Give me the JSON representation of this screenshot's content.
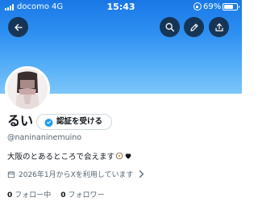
{
  "status_bar": {
    "carrier": "docomo",
    "network": "4G",
    "time": "15:43",
    "battery_percent": "69%",
    "battery_level": 0.69,
    "rotation_lock_icon": "rotation-lock-icon"
  },
  "header": {
    "back_icon": "arrow-left-icon",
    "search_icon": "search-icon",
    "edit_icon": "pencil-icon",
    "share_icon": "share-icon"
  },
  "profile": {
    "display_name": "るい",
    "verify_button_label": "認証を受ける",
    "handle": "@naninaninemuino",
    "bio": "大阪のとあるところで会えます",
    "bio_emojis": [
      "sparkle-emoji",
      "heart-emoji"
    ],
    "joined": "2026年1月からXを利用しています",
    "following_count": "0",
    "following_label": "フォロー中",
    "followers_count": "0",
    "followers_label": "フォロワー"
  },
  "colors": {
    "banner_top": "#1a78e6",
    "banner_bottom": "#7dc6fa",
    "verified_badge": "#1d9bf0",
    "secondary_text": "#536471",
    "primary_text": "#0f1419"
  }
}
